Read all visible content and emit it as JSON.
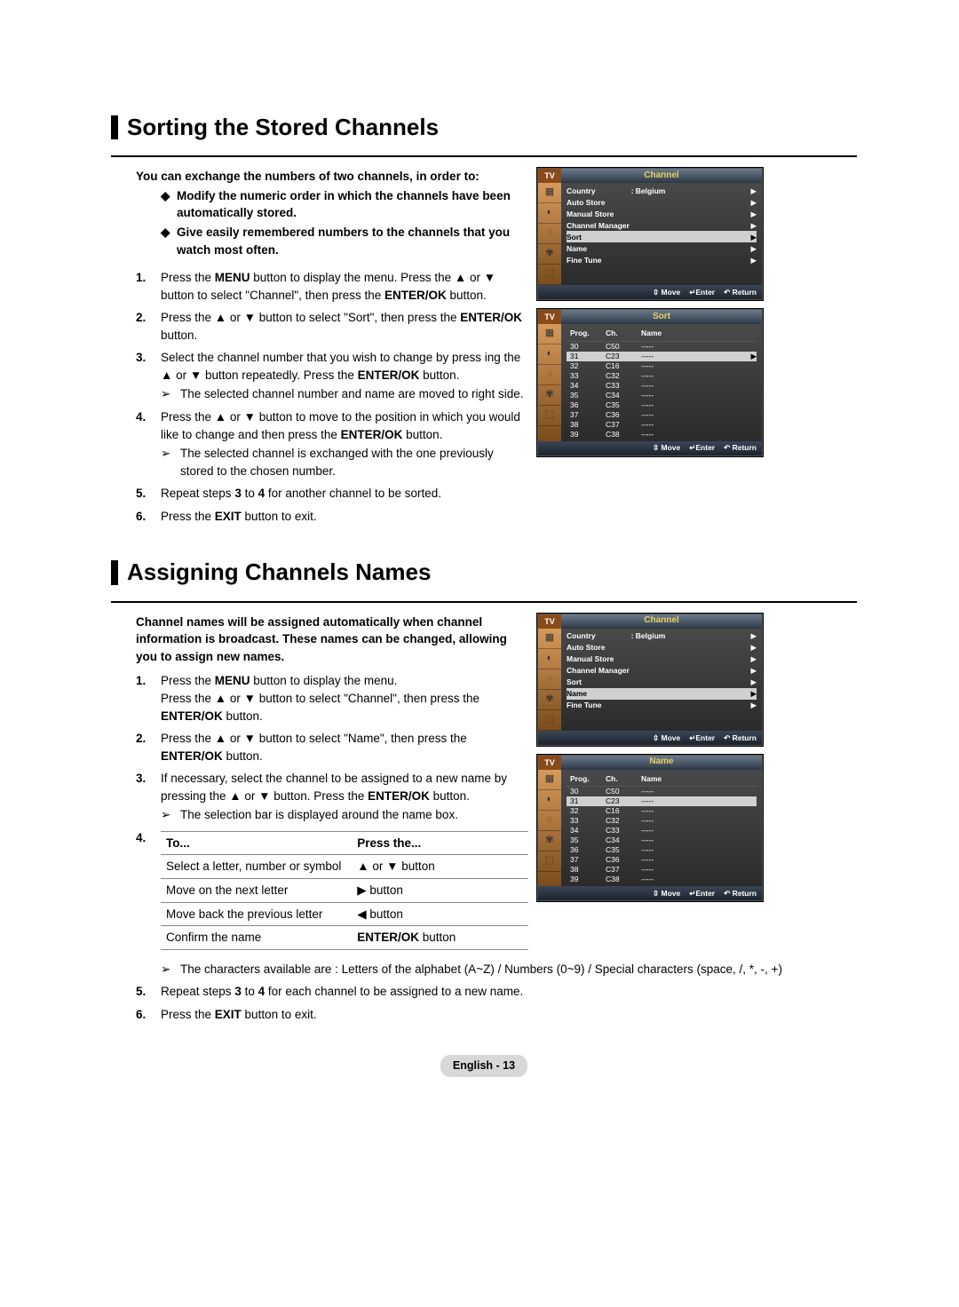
{
  "section1": {
    "title": "Sorting the Stored Channels",
    "intro": "You can exchange the numbers of two channels, in order to:",
    "bullets": [
      "Modify the numeric order in which the channels have been automatically stored.",
      "Give easily remembered numbers to the channels that you watch most often."
    ],
    "steps": {
      "s1_a": "Press the ",
      "s1_b": "MENU",
      "s1_c": " button to display the menu.  Press the ▲ or ▼ button to select \"Channel\", then press the ",
      "s1_d": "ENTER/OK",
      "s1_e": " button.",
      "s2_a": "Press the ▲ or ▼ button to select \"Sort\", then press the ",
      "s2_b": "ENTER/OK",
      "s2_c": " button.",
      "s3_a": "Select the channel number that you wish to change by press ing the ▲ or ▼ button repeatedly. Press the ",
      "s3_b": "ENTER/OK",
      "s3_c": " button.",
      "s3_sub": "The selected channel number and name are moved to right side.",
      "s4_a": "Press the ▲ or ▼ button to move to the position in which you would like to change and then press the ",
      "s4_b": "ENTER/OK",
      "s4_c": " button.",
      "s4_sub": "The selected channel is exchanged with the one previously stored to the chosen number.",
      "s5_a": "Repeat steps ",
      "s5_b": "3",
      "s5_c": " to ",
      "s5_d": "4",
      "s5_e": " for another channel to be sorted.",
      "s6_a": "Press the ",
      "s6_b": "EXIT",
      "s6_c": " button to exit."
    }
  },
  "section2": {
    "title": "Assigning Channels Names",
    "intro": "Channel names will be assigned automatically when channel information is broadcast. These names can be changed, allowing you to assign new names.",
    "steps": {
      "s1_a": "Press the ",
      "s1_b": "MENU",
      "s1_c": " button to display the menu.",
      "s1_d": "Press the ▲ or ▼ button to select \"Channel\", then press the ",
      "s1_e": "ENTER/OK",
      "s1_f": " button.",
      "s2_a": "Press the ▲ or ▼ button to select \"Name\", then press the ",
      "s2_b": "ENTER/OK",
      "s2_c": " button.",
      "s3_a": "If necessary, select the channel to be assigned to a new name by pressing the ▲ or ▼ button. Press the ",
      "s3_b": "ENTER/OK",
      "s3_c": " button.",
      "s3_sub": "The selection bar is displayed around the name box.",
      "s4_tbl": {
        "h1": "To...",
        "h2": "Press the...",
        "r1a": "Select a letter, number or symbol",
        "r1b": "▲ or ▼ button",
        "r2a": "Move on the next letter",
        "r2b": "▶ button",
        "r3a": "Move back the previous letter",
        "r3b": "◀ button",
        "r4a": "Confirm the name",
        "r4b1": "ENTER/OK",
        "r4b2": " button"
      },
      "s4_sub": "The characters available are : Letters of the alphabet (A~Z) / Numbers (0~9) / Special characters (space, /, *, -, +)",
      "s5_a": "Repeat steps ",
      "s5_b": "3",
      "s5_c": " to ",
      "s5_d": "4",
      "s5_e": " for each channel to be assigned to a new name.",
      "s6_a": "Press the ",
      "s6_b": "EXIT",
      "s6_c": " button to exit."
    }
  },
  "osd": {
    "tv": "TV",
    "channel_title": "Channel",
    "sort_title": "Sort",
    "name_title": "Name",
    "menu": {
      "country": "Country",
      "country_val": ": Belgium",
      "auto": "Auto Store",
      "manual": "Manual Store",
      "cm": "Channel Manager",
      "sort": "Sort",
      "name": "Name",
      "fine": "Fine Tune"
    },
    "footer": {
      "move": "Move",
      "enter": "Enter",
      "return": "Return"
    },
    "cols": {
      "prog": "Prog.",
      "ch": "Ch.",
      "name": "Name"
    },
    "rows": [
      {
        "p": "30",
        "c": "C50",
        "n": "-----"
      },
      {
        "p": "31",
        "c": "C23",
        "n": "-----"
      },
      {
        "p": "32",
        "c": "C16",
        "n": "-----"
      },
      {
        "p": "33",
        "c": "C32",
        "n": "-----"
      },
      {
        "p": "34",
        "c": "C33",
        "n": "-----"
      },
      {
        "p": "35",
        "c": "C34",
        "n": "-----"
      },
      {
        "p": "36",
        "c": "C35",
        "n": "-----"
      },
      {
        "p": "37",
        "c": "C36",
        "n": "-----"
      },
      {
        "p": "38",
        "c": "C37",
        "n": "-----"
      },
      {
        "p": "39",
        "c": "C38",
        "n": "-----"
      }
    ]
  },
  "footer": {
    "label": "English - 13"
  },
  "glyph": {
    "diamond": "◆",
    "sub": "➢",
    "updown": "⇳",
    "enter_sym": "↵",
    "return_sym": "↶",
    "tri": "▶"
  }
}
